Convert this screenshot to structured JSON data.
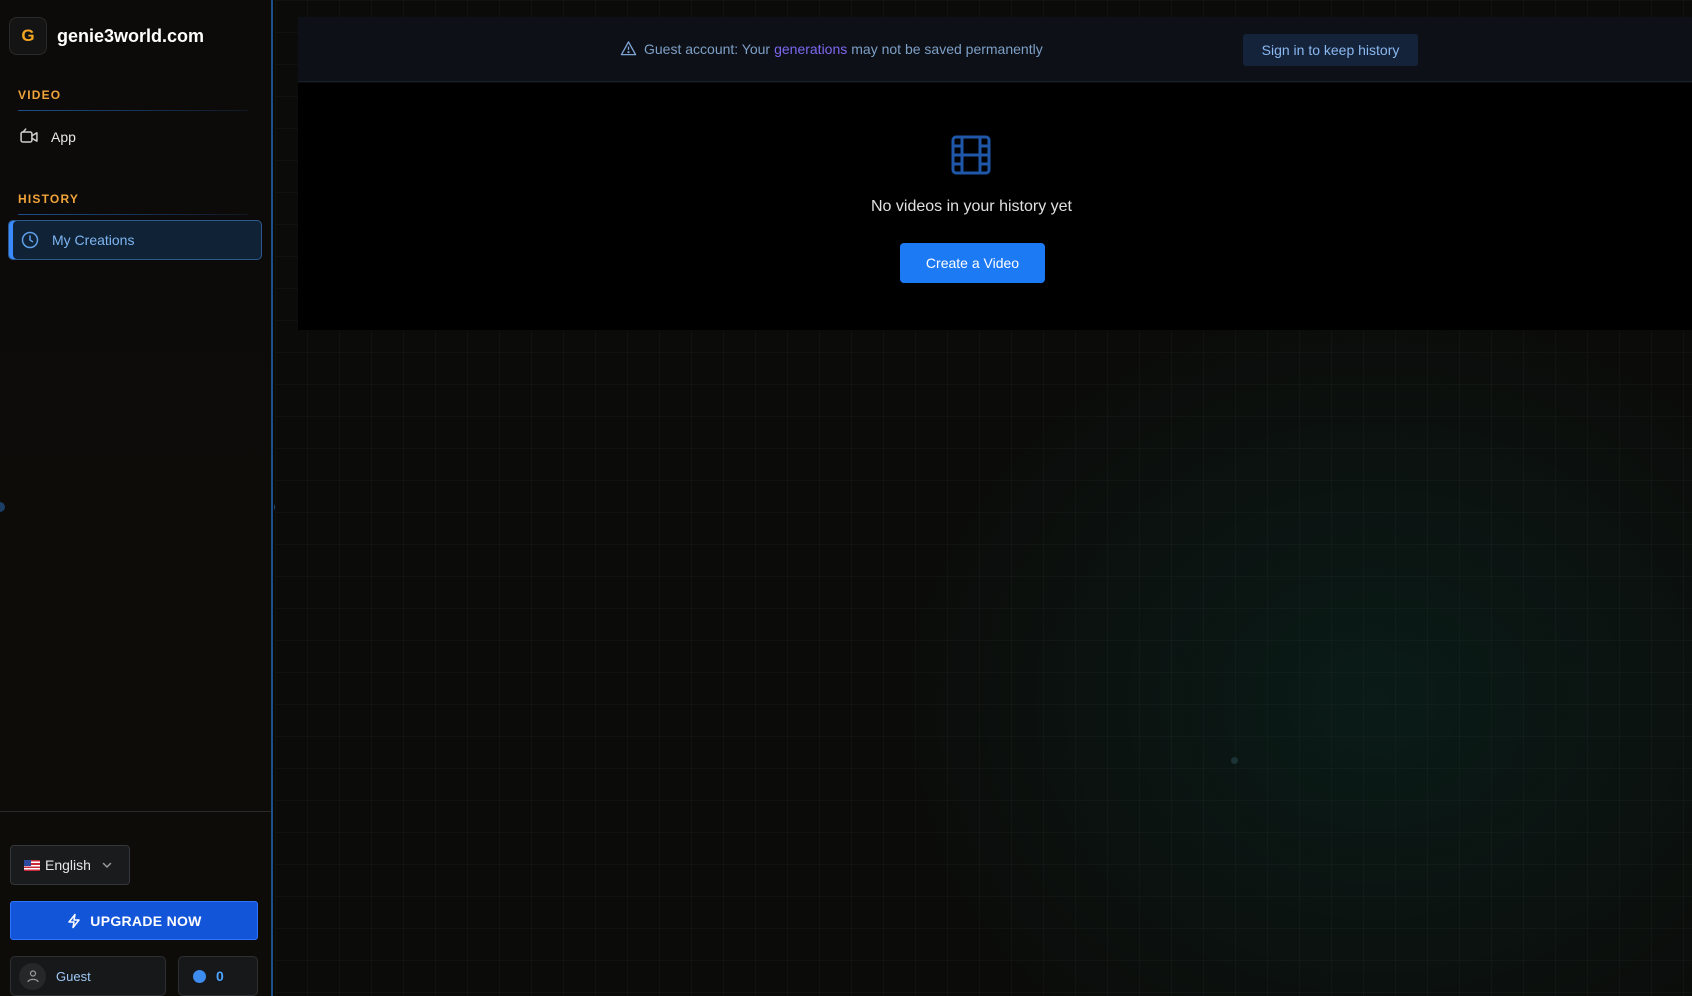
{
  "brand": {
    "logo_letter": "G",
    "name": "genie3world.com"
  },
  "sidebar": {
    "sections": [
      {
        "label": "VIDEO",
        "items": [
          {
            "label": "App",
            "icon": "video-camera-icon"
          }
        ]
      },
      {
        "label": "HISTORY",
        "items": [
          {
            "label": "My Creations",
            "icon": "clock-icon",
            "active": true
          }
        ]
      }
    ],
    "language": {
      "selected": "English",
      "flag": "us-flag"
    },
    "upgrade_label": "UPGRADE NOW",
    "user": {
      "name": "Guest"
    },
    "credits": {
      "count": "0"
    }
  },
  "banner": {
    "message_prefix": "Guest account: Your",
    "message_link": "generations",
    "message_suffix": "may not be saved permanently",
    "signin_label": "Sign in to keep history"
  },
  "empty_state": {
    "message": "No videos in your history yet",
    "button_label": "Create a Video",
    "icon": "film-icon"
  },
  "colors": {
    "accent_blue": "#1c7af5",
    "upgrade_blue": "#1255d9",
    "section_orange": "#f0a43a",
    "link_purple": "#7c68f0"
  }
}
